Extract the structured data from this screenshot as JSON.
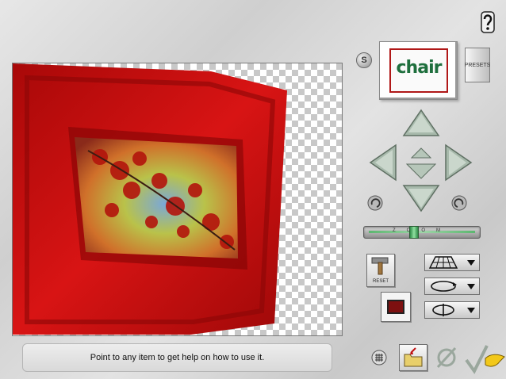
{
  "preview": {
    "label": "Preview canvas"
  },
  "thumbnail": {
    "text": "chair"
  },
  "buttons": {
    "s_badge": "S",
    "presets": "PRESETS",
    "reset": "RESET"
  },
  "zoom": {
    "label": "ZOOM",
    "level": 0.42
  },
  "help": {
    "text": "Point to any item to get help on how to use it."
  },
  "icons": {
    "help": "question-icon",
    "grid": "grid-icon",
    "open": "open-folder-icon",
    "cancel": "cancel-icon",
    "ok": "checkmark-icon"
  },
  "colors": {
    "frame_red": "#c80f0f",
    "arrow_green": "#9fb2a3"
  }
}
